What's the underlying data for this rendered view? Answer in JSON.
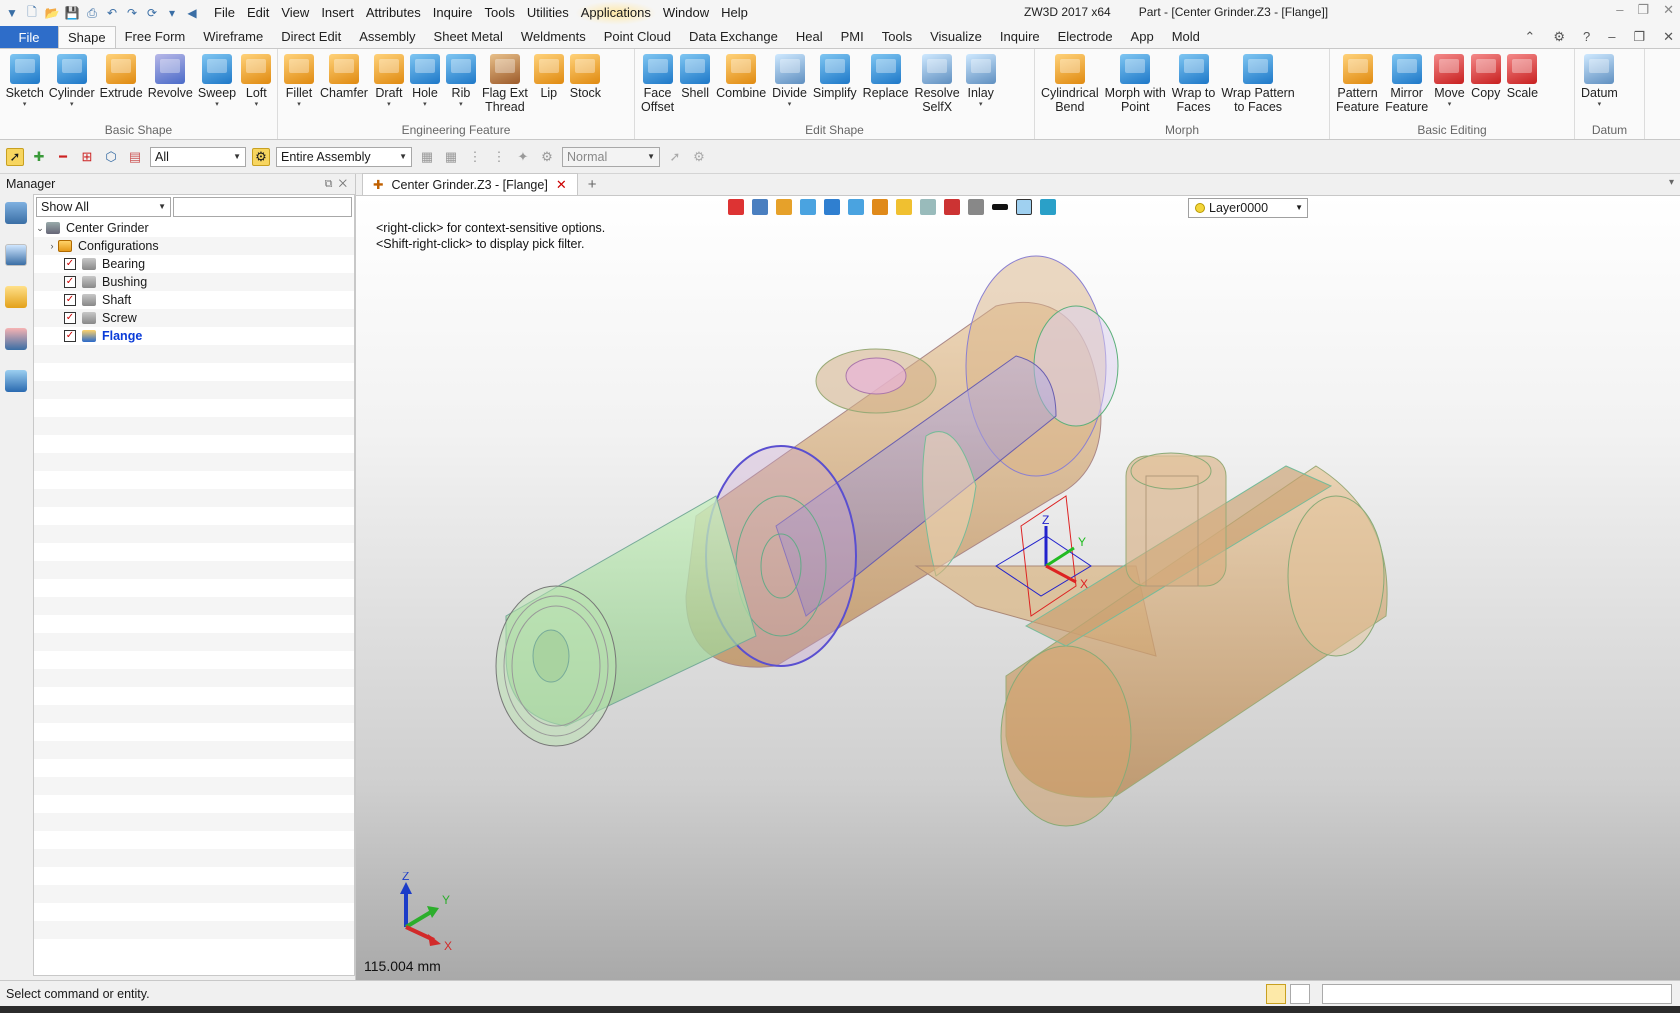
{
  "titlebar": {
    "menus": [
      "File",
      "Edit",
      "View",
      "Insert",
      "Attributes",
      "Inquire",
      "Tools",
      "Utilities",
      "Applications",
      "Window",
      "Help"
    ],
    "app": "ZW3D 2017  x64",
    "document": "Part - [Center Grinder.Z3 - [Flange]]"
  },
  "ribbon_tabs": {
    "file": "File",
    "tabs": [
      "Shape",
      "Free Form",
      "Wireframe",
      "Direct Edit",
      "Assembly",
      "Sheet Metal",
      "Weldments",
      "Point Cloud",
      "Data Exchange",
      "Heal",
      "PMI",
      "Tools",
      "Visualize",
      "Inquire",
      "Electrode",
      "App",
      "Mold"
    ],
    "active": "Shape"
  },
  "ribbon": {
    "basic_shape": {
      "label": "Basic Shape",
      "tools": [
        "Sketch",
        "Cylinder",
        "Extrude",
        "Revolve",
        "Sweep",
        "Loft"
      ]
    },
    "engineering_feature": {
      "label": "Engineering Feature",
      "tools": [
        "Fillet",
        "Chamfer",
        "Draft",
        "Hole",
        "Rib",
        "Flag Ext\nThread",
        "Lip",
        "Stock"
      ]
    },
    "edit_shape": {
      "label": "Edit Shape",
      "tools": [
        "Face\nOffset",
        "Shell",
        "Combine",
        "Divide",
        "Simplify",
        "Replace",
        "Resolve\nSelfX",
        "Inlay"
      ]
    },
    "morph": {
      "label": "Morph",
      "tools": [
        "Cylindrical\nBend",
        "Morph with\nPoint",
        "Wrap to\nFaces",
        "Wrap Pattern\nto Faces"
      ]
    },
    "basic_editing": {
      "label": "Basic Editing",
      "tools": [
        "Pattern\nFeature",
        "Mirror\nFeature",
        "Move",
        "Copy",
        "Scale"
      ]
    },
    "datum": {
      "label": "Datum",
      "tools": [
        "Datum"
      ]
    }
  },
  "toolbar2": {
    "filter": "All",
    "scope": "Entire Assembly",
    "render_mode": "Normal"
  },
  "manager": {
    "title": "Manager",
    "filter": "Show All",
    "search_placeholder": "",
    "tree": {
      "root": "Center Grinder",
      "configurations": "Configurations",
      "parts": [
        "Bearing",
        "Bushing",
        "Shaft",
        "Screw"
      ],
      "active_part": "Flange"
    }
  },
  "document_tab": {
    "label": "Center Grinder.Z3 - [Flange]"
  },
  "viewport": {
    "hint1": "<right-click> for context-sensitive options.",
    "hint2": "<Shift-right-click> to display pick filter.",
    "layer": "Layer0000",
    "scale": "115.004 mm",
    "axes": {
      "x": "X",
      "y": "Y",
      "z": "Z"
    }
  },
  "status": {
    "message": "Select command or entity."
  },
  "colors": {
    "accent": "#2e6dc9",
    "part_bronze": "#c49a5f",
    "part_green": "#9fd79a",
    "part_purple": "#8a7fd1"
  }
}
